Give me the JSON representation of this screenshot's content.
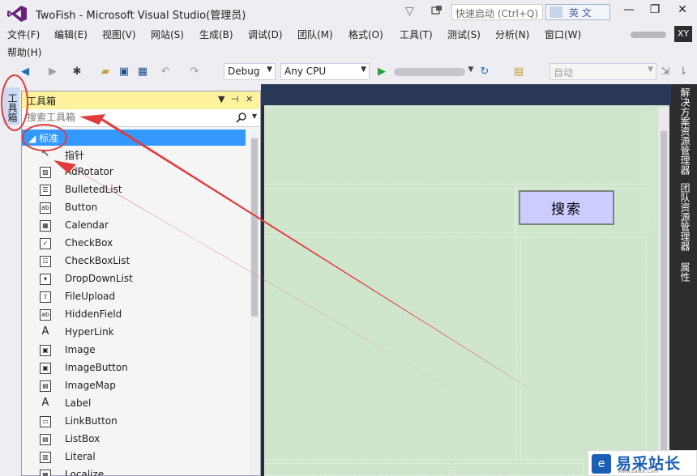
{
  "window": {
    "title": "TwoFish - Microsoft Visual Studio(管理员)",
    "quick_launch_placeholder": "快速启动 (Ctrl+Q)",
    "ime_label": "英 文",
    "minimize": "—",
    "restore": "❐",
    "close": "✕"
  },
  "menu": {
    "items": [
      "文件(F)",
      "编辑(E)",
      "视图(V)",
      "网站(S)",
      "生成(B)",
      "调试(D)",
      "团队(M)",
      "格式(O)",
      "工具(T)",
      "测试(S)",
      "分析(N)",
      "窗口(W)"
    ],
    "help": "帮助(H)",
    "user_initials": "XY"
  },
  "toolbar": {
    "config": "Debug",
    "platform": "Any CPU",
    "run_icon": "play-icon",
    "auto_combo": "自动"
  },
  "left_tab": {
    "label": "工具箱"
  },
  "toolbox": {
    "title": "工具箱",
    "search_placeholder": "搜索工具箱",
    "group": "标准",
    "items": [
      {
        "label": "指针",
        "icon": "pointer-icon"
      },
      {
        "label": "AdRotator",
        "icon": "adrotator-icon"
      },
      {
        "label": "BulletedList",
        "icon": "bulletedlist-icon"
      },
      {
        "label": "Button",
        "icon": "button-icon"
      },
      {
        "label": "Calendar",
        "icon": "calendar-icon"
      },
      {
        "label": "CheckBox",
        "icon": "checkbox-icon"
      },
      {
        "label": "CheckBoxList",
        "icon": "checkboxlist-icon"
      },
      {
        "label": "DropDownList",
        "icon": "dropdownlist-icon"
      },
      {
        "label": "FileUpload",
        "icon": "fileupload-icon"
      },
      {
        "label": "HiddenField",
        "icon": "hiddenfield-icon"
      },
      {
        "label": "HyperLink",
        "icon": "hyperlink-icon"
      },
      {
        "label": "Image",
        "icon": "image-icon"
      },
      {
        "label": "ImageButton",
        "icon": "imagebutton-icon"
      },
      {
        "label": "ImageMap",
        "icon": "imagemap-icon"
      },
      {
        "label": "Label",
        "icon": "label-icon"
      },
      {
        "label": "LinkButton",
        "icon": "linkbutton-icon"
      },
      {
        "label": "ListBox",
        "icon": "listbox-icon"
      },
      {
        "label": "Literal",
        "icon": "literal-icon"
      },
      {
        "label": "Localize",
        "icon": "localize-icon"
      }
    ]
  },
  "designer": {
    "search_button": "搜索"
  },
  "right_tabs": [
    "解决方案资源管理器",
    "团队资源管理器",
    "属性"
  ],
  "watermark": {
    "text": "易采站长站",
    "sub": "Www.Easck.Com"
  },
  "colors": {
    "annotation_red": "#e03c3c",
    "toolbox_header": "#fff29d",
    "selection_blue": "#3399ff",
    "designer_green": "#cfe6cd"
  }
}
